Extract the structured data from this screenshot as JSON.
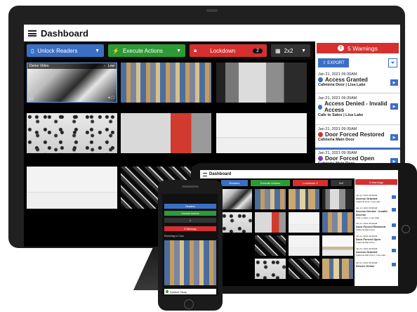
{
  "desktop": {
    "title": "Dashboard",
    "toolbar": {
      "unlock_label": "Unlock Readers",
      "execute_label": "Execute Actions",
      "lockdown_label": "Lockdown",
      "lockdown_count": "2",
      "grid_label": "2x2"
    },
    "tiles": [
      {
        "label": "Demo Video",
        "quality": "Low"
      }
    ],
    "sidebar": {
      "warnings_label": "5 Warnings",
      "export_label": "EXPORT",
      "events": [
        {
          "time": "Jan 21, 2021 09:30AM",
          "title": "Access Granted",
          "location": "Cafeteria Door | Lisa Lake",
          "color": "#3b6fc4"
        },
        {
          "time": "Jan 21, 2021 09:30AM",
          "title": "Access Denied - Invalid Access",
          "location": "Cafe to Sales | Lisa Lake",
          "color": "#3b6fc4"
        },
        {
          "time": "Jan 21, 2021 09:30AM",
          "title": "Door Forced Restored",
          "location": "Cafeteria Main Door",
          "color": "#d62f2f"
        },
        {
          "time": "Jan 21, 2021 09:30AM",
          "title": "Door Forced Open",
          "location": "Cafeteria Main Door",
          "color": "#7a3fb0"
        }
      ]
    }
  },
  "tablet": {
    "title": "Dashboard",
    "toolbar": {
      "unlock_label": "Readers",
      "execute_label": "Execute Actions",
      "lockdown_label": "Lockdown",
      "lockdown_count": "2",
      "grid_label": "2x2"
    },
    "sidebar": {
      "warnings_label": "5 Warnings",
      "events": [
        {
          "time": "Jan 21, 2021 09:30AM",
          "title": "Access Granted",
          "location": "Cafeteria Door | Lisa Lake"
        },
        {
          "time": "Jan 21, 2021 09:30AM",
          "title": "Access Denied - Invalid Access",
          "location": "Cafe to Sales | Lisa Lake"
        },
        {
          "time": "Jan 21, 2021 09:30AM",
          "title": "Door Forced Restored",
          "location": "Cafeteria Main Door"
        },
        {
          "time": "Jan 21, 2021 09:30AM",
          "title": "Door Forced Open",
          "location": "Cafeteria Main Door"
        },
        {
          "time": "Jan 21, 2021 09:30AM",
          "title": "Access Granted",
          "location": "Cafeteria Main Door | Lisa Lake"
        },
        {
          "time": "Jan 21, 2021 09:30AM",
          "title": "Device Online",
          "location": ""
        }
      ]
    }
  },
  "phone": {
    "readers_label": "Readers",
    "execute_label": "Execute Actions",
    "select_value": "1",
    "warnings_label": "5 Warnings",
    "camera_label": "Receiving to Cam",
    "status_label": "System Okay"
  },
  "colors": {
    "blue": "#3b6fc4",
    "green": "#2e9a36",
    "red": "#d62f2f"
  }
}
